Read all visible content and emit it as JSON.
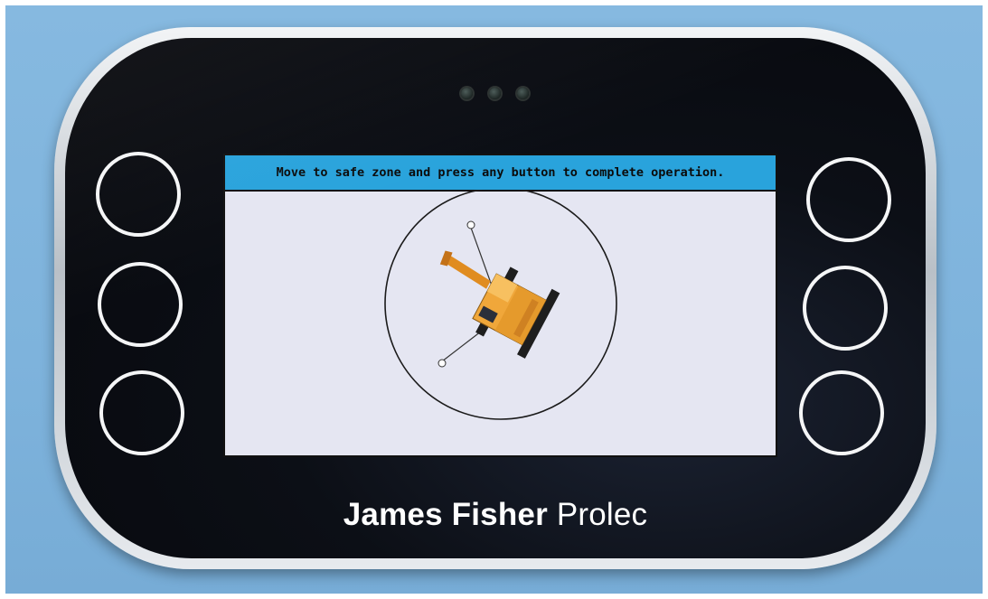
{
  "screen": {
    "message": "Move to safe zone and press any button to complete operation."
  },
  "brand": {
    "name_bold": "James Fisher",
    "name_light": "Prolec"
  },
  "colors": {
    "banner": "#29a3dc",
    "screen_bg": "#e5e6f2",
    "machine": "#f0a73a"
  },
  "icons": {
    "machine": "excavator-icon"
  }
}
